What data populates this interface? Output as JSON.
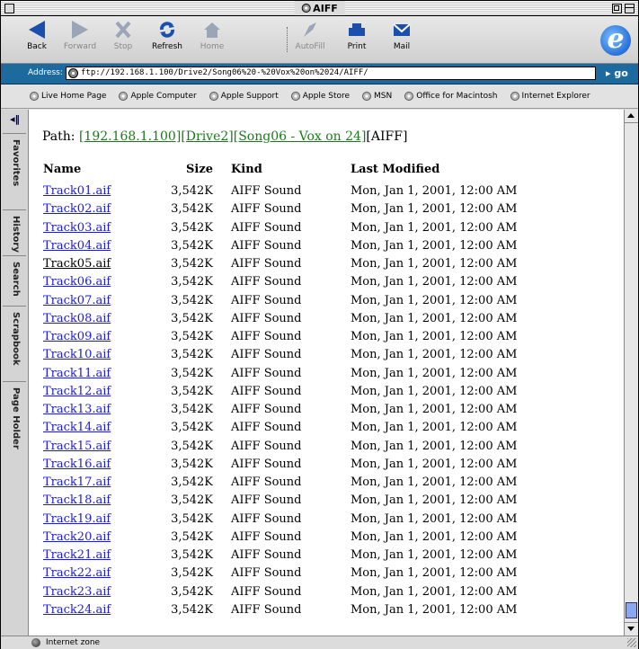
{
  "window": {
    "title": "AIFF"
  },
  "toolbar": {
    "buttons": [
      {
        "label": "Back",
        "icon": "back-arrow-icon"
      },
      {
        "label": "Forward",
        "icon": "forward-arrow-icon"
      },
      {
        "label": "Stop",
        "icon": "stop-x-icon"
      },
      {
        "label": "Refresh",
        "icon": "refresh-icon"
      },
      {
        "label": "Home",
        "icon": "home-icon"
      },
      {
        "label": "AutoFill",
        "icon": "autofill-icon"
      },
      {
        "label": "Print",
        "icon": "print-icon"
      },
      {
        "label": "Mail",
        "icon": "mail-icon"
      }
    ]
  },
  "address": {
    "label": "Address:",
    "url": "ftp://192.168.1.100/Drive2/Song06%20-%20Vox%20on%2024/AIFF/",
    "go_label": "go"
  },
  "favorites": [
    "Live Home Page",
    "Apple Computer",
    "Apple Support",
    "Apple Store",
    "MSN",
    "Office for Macintosh",
    "Internet Explorer"
  ],
  "sidebar": {
    "tabs": [
      "Favorites",
      "History",
      "Search",
      "Scrapbook",
      "Page Holder"
    ]
  },
  "content": {
    "path_label": "Path:",
    "path_links": [
      "[192.168.1.100]",
      "[Drive2]",
      "[Song06 - Vox on 24]"
    ],
    "path_current": "[AIFF]",
    "headers": {
      "name": "Name",
      "size": "Size",
      "kind": "Kind",
      "modified": "Last Modified"
    },
    "files": [
      {
        "name": "Track01.aif",
        "size": "3,542K",
        "kind": "AIFF Sound",
        "modified": "Mon, Jan 1, 2001, 12:00 AM"
      },
      {
        "name": "Track02.aif",
        "size": "3,542K",
        "kind": "AIFF Sound",
        "modified": "Mon, Jan 1, 2001, 12:00 AM"
      },
      {
        "name": "Track03.aif",
        "size": "3,542K",
        "kind": "AIFF Sound",
        "modified": "Mon, Jan 1, 2001, 12:00 AM"
      },
      {
        "name": "Track04.aif",
        "size": "3,542K",
        "kind": "AIFF Sound",
        "modified": "Mon, Jan 1, 2001, 12:00 AM"
      },
      {
        "name": "Track05.aif",
        "size": "3,542K",
        "kind": "AIFF Sound",
        "modified": "Mon, Jan 1, 2001, 12:00 AM"
      },
      {
        "name": "Track06.aif",
        "size": "3,542K",
        "kind": "AIFF Sound",
        "modified": "Mon, Jan 1, 2001, 12:00 AM"
      },
      {
        "name": "Track07.aif",
        "size": "3,542K",
        "kind": "AIFF Sound",
        "modified": "Mon, Jan 1, 2001, 12:00 AM"
      },
      {
        "name": "Track08.aif",
        "size": "3,542K",
        "kind": "AIFF Sound",
        "modified": "Mon, Jan 1, 2001, 12:00 AM"
      },
      {
        "name": "Track09.aif",
        "size": "3,542K",
        "kind": "AIFF Sound",
        "modified": "Mon, Jan 1, 2001, 12:00 AM"
      },
      {
        "name": "Track10.aif",
        "size": "3,542K",
        "kind": "AIFF Sound",
        "modified": "Mon, Jan 1, 2001, 12:00 AM"
      },
      {
        "name": "Track11.aif",
        "size": "3,542K",
        "kind": "AIFF Sound",
        "modified": "Mon, Jan 1, 2001, 12:00 AM"
      },
      {
        "name": "Track12.aif",
        "size": "3,542K",
        "kind": "AIFF Sound",
        "modified": "Mon, Jan 1, 2001, 12:00 AM"
      },
      {
        "name": "Track13.aif",
        "size": "3,542K",
        "kind": "AIFF Sound",
        "modified": "Mon, Jan 1, 2001, 12:00 AM"
      },
      {
        "name": "Track14.aif",
        "size": "3,542K",
        "kind": "AIFF Sound",
        "modified": "Mon, Jan 1, 2001, 12:00 AM"
      },
      {
        "name": "Track15.aif",
        "size": "3,542K",
        "kind": "AIFF Sound",
        "modified": "Mon, Jan 1, 2001, 12:00 AM"
      },
      {
        "name": "Track16.aif",
        "size": "3,542K",
        "kind": "AIFF Sound",
        "modified": "Mon, Jan 1, 2001, 12:00 AM"
      },
      {
        "name": "Track17.aif",
        "size": "3,542K",
        "kind": "AIFF Sound",
        "modified": "Mon, Jan 1, 2001, 12:00 AM"
      },
      {
        "name": "Track18.aif",
        "size": "3,542K",
        "kind": "AIFF Sound",
        "modified": "Mon, Jan 1, 2001, 12:00 AM"
      },
      {
        "name": "Track19.aif",
        "size": "3,542K",
        "kind": "AIFF Sound",
        "modified": "Mon, Jan 1, 2001, 12:00 AM"
      },
      {
        "name": "Track20.aif",
        "size": "3,542K",
        "kind": "AIFF Sound",
        "modified": "Mon, Jan 1, 2001, 12:00 AM"
      },
      {
        "name": "Track21.aif",
        "size": "3,542K",
        "kind": "AIFF Sound",
        "modified": "Mon, Jan 1, 2001, 12:00 AM"
      },
      {
        "name": "Track22.aif",
        "size": "3,542K",
        "kind": "AIFF Sound",
        "modified": "Mon, Jan 1, 2001, 12:00 AM"
      },
      {
        "name": "Track23.aif",
        "size": "3,542K",
        "kind": "AIFF Sound",
        "modified": "Mon, Jan 1, 2001, 12:00 AM"
      },
      {
        "name": "Track24.aif",
        "size": "3,542K",
        "kind": "AIFF Sound",
        "modified": "Mon, Jan 1, 2001, 12:00 AM"
      }
    ],
    "visited_index": 4
  },
  "status": {
    "text": "Internet zone"
  },
  "colors": {
    "link": "#1a1aee",
    "path_link": "#1a7a1a",
    "address_bar": "#1d6a9e"
  }
}
